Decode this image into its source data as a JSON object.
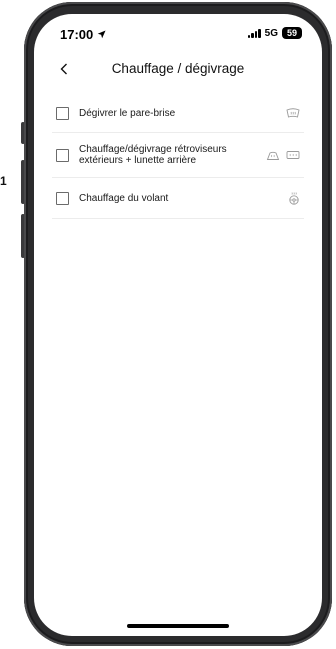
{
  "side_label": "1",
  "status_bar": {
    "time": "17:00",
    "network": "5G",
    "battery": "59"
  },
  "header": {
    "title": "Chauffage / dégivrage"
  },
  "options": [
    {
      "label": "Dégivrer le pare-brise",
      "checked": false,
      "icons": [
        "windshield-defrost-icon"
      ]
    },
    {
      "label_line1": "Chauffage/dégivrage rétroviseurs",
      "label_line2": "extérieurs + lunette arrière",
      "checked": false,
      "icons": [
        "side-mirror-heat-icon",
        "rear-window-defrost-icon"
      ]
    },
    {
      "label": "Chauffage du volant",
      "checked": false,
      "icons": [
        "steering-wheel-heat-icon"
      ]
    }
  ],
  "colors": {
    "accent": "#000000",
    "divider": "#ececec",
    "icon": "#9a9a9a"
  }
}
